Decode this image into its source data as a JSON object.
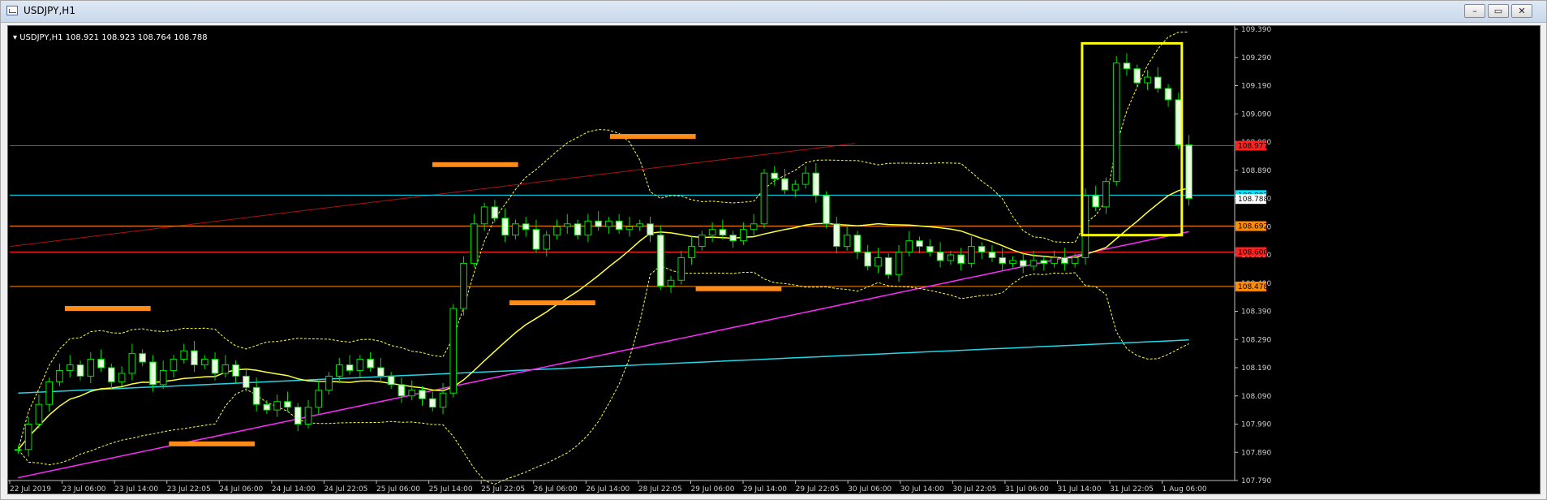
{
  "window": {
    "title": "USDJPY,H1",
    "buttons": {
      "minimize": "–",
      "restore": "▭",
      "close": "✕"
    }
  },
  "chart_info": {
    "header": "USDJPY,H1  108.921 108.923 108.764 108.788"
  },
  "chart_data": {
    "type": "candlestick",
    "symbol": "USDJPY",
    "timeframe": "H1",
    "ohlc_last": {
      "open": 108.921,
      "high": 108.923,
      "low": 108.764,
      "close": 108.788
    },
    "ylim": [
      107.79,
      109.39
    ],
    "y_ticks": [
      "109.390",
      "109.290",
      "109.190",
      "109.090",
      "108.990",
      "108.890",
      "108.790",
      "108.690",
      "108.590",
      "108.490",
      "108.390",
      "108.290",
      "108.190",
      "108.090",
      "107.990",
      "107.890",
      "107.790"
    ],
    "x_ticks": [
      "22 Jul 2019",
      "23 Jul 06:00",
      "23 Jul 14:00",
      "23 Jul 22:05",
      "24 Jul 06:00",
      "24 Jul 14:00",
      "24 Jul 22:05",
      "25 Jul 06:00",
      "25 Jul 14:00",
      "25 Jul 22:05",
      "26 Jul 06:00",
      "26 Jul 14:00",
      "28 Jul 22:05",
      "29 Jul 06:00",
      "29 Jul 14:00",
      "29 Jul 22:05",
      "30 Jul 06:00",
      "30 Jul 14:00",
      "30 Jul 22:05",
      "31 Jul 06:00",
      "31 Jul 14:00",
      "31 Jul 22:05",
      "1 Aug 06:00"
    ],
    "price_labels": [
      {
        "value": 108.977,
        "text": "108.977",
        "color": "#ff2020"
      },
      {
        "value": 108.802,
        "text": "108.802",
        "color": "#00e5ff"
      },
      {
        "value": 108.788,
        "text": "108.788",
        "color": "#ffffff"
      },
      {
        "value": 108.692,
        "text": "108.692",
        "color": "#ff8c00"
      },
      {
        "value": 108.6,
        "text": "108.600",
        "color": "#ff2020"
      },
      {
        "value": 108.478,
        "text": "108.478",
        "color": "#ff8c00"
      }
    ],
    "horizontal_levels": [
      {
        "value": 108.977,
        "color": "#ff2020"
      },
      {
        "value": 108.802,
        "color": "#00e5ff"
      },
      {
        "value": 108.692,
        "color": "#ff8c00"
      },
      {
        "value": 108.6,
        "color": "#ff2020"
      },
      {
        "value": 108.478,
        "color": "#ff8c00"
      }
    ],
    "trendline": {
      "from": [
        0,
        108.62
      ],
      "to": [
        0.69,
        108.985
      ],
      "color": "#b01010"
    },
    "closes": [
      107.9,
      107.99,
      108.06,
      108.14,
      108.18,
      108.2,
      108.16,
      108.22,
      108.19,
      108.14,
      108.17,
      108.24,
      108.21,
      108.13,
      108.18,
      108.22,
      108.25,
      108.2,
      108.22,
      108.17,
      108.2,
      108.16,
      108.12,
      108.06,
      108.04,
      108.07,
      108.05,
      107.99,
      108.05,
      108.11,
      108.16,
      108.2,
      108.18,
      108.22,
      108.19,
      108.16,
      108.13,
      108.09,
      108.11,
      108.08,
      108.05,
      108.1,
      108.4,
      108.56,
      108.7,
      108.76,
      108.72,
      108.66,
      108.7,
      108.68,
      108.61,
      108.66,
      108.69,
      108.7,
      108.66,
      108.71,
      108.69,
      108.71,
      108.68,
      108.69,
      108.7,
      108.66,
      108.48,
      108.5,
      108.58,
      108.62,
      108.66,
      108.68,
      108.66,
      108.64,
      108.68,
      108.7,
      108.88,
      108.86,
      108.82,
      108.84,
      108.88,
      108.8,
      108.7,
      108.62,
      108.66,
      108.6,
      108.55,
      108.58,
      108.52,
      108.6,
      108.64,
      108.62,
      108.6,
      108.57,
      108.59,
      108.56,
      108.62,
      108.6,
      108.58,
      108.56,
      108.57,
      108.55,
      108.57,
      108.56,
      108.58,
      108.56,
      108.58,
      108.8,
      108.76,
      108.85,
      109.27,
      109.25,
      109.2,
      109.22,
      109.18,
      109.14,
      108.98,
      108.79
    ],
    "bands": {
      "ma_color": "#ffff40",
      "band_color": "#ffff40"
    },
    "ma_slow_color": "#ff2bff",
    "ma_long_color": "#20d8e8",
    "zones_color": "#ff8c1a",
    "highlight_box_color": "#ffff00",
    "candle_up_color": "#00e000",
    "candle_body_color": "#e8ffe0"
  }
}
